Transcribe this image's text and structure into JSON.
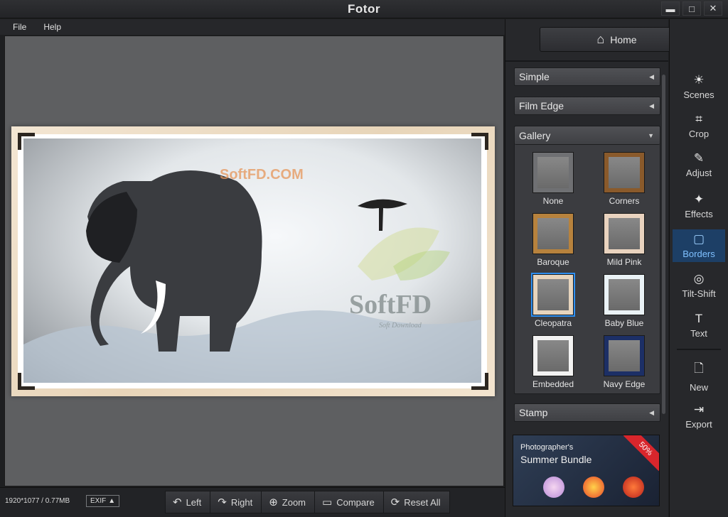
{
  "app": {
    "title": "Fotor"
  },
  "window_controls": {
    "minimize": "▬",
    "maximize": "□",
    "close": "✕"
  },
  "menu": [
    "File",
    "Help"
  ],
  "canvas": {
    "watermark_top": "SoftFD.COM",
    "watermark_big": "SoftFD",
    "watermark_small": "Soft Download"
  },
  "status": {
    "dimensions": "1920*1077 / 0.77MB",
    "exif": "EXIF"
  },
  "toolbar": [
    {
      "label": "Left",
      "icon": "rotate-left-icon"
    },
    {
      "label": "Right",
      "icon": "rotate-right-icon"
    },
    {
      "label": "Zoom",
      "icon": "zoom-icon"
    },
    {
      "label": "Compare",
      "icon": "compare-icon"
    },
    {
      "label": "Reset All",
      "icon": "reset-icon"
    }
  ],
  "home": {
    "label": "Home"
  },
  "accordion": {
    "simple": "Simple",
    "film_edge": "Film Edge",
    "gallery": "Gallery",
    "stamp": "Stamp"
  },
  "gallery_items": [
    {
      "label": "None",
      "color": "#6f7073"
    },
    {
      "label": "Corners",
      "color": "#8a5a2b"
    },
    {
      "label": "Baroque",
      "color": "#b7823d"
    },
    {
      "label": "Mild Pink",
      "color": "#e9d3bf"
    },
    {
      "label": "Cleopatra",
      "color": "#e6d4bd",
      "selected": true
    },
    {
      "label": "Baby Blue",
      "color": "#eaf2f6"
    },
    {
      "label": "Embedded",
      "color": "#f2f2f2"
    },
    {
      "label": "Navy Edge",
      "color": "#1c2f66"
    }
  ],
  "promo": {
    "line1": "Photographer's",
    "line2": "Summer Bundle",
    "badge": "50%"
  },
  "side_tools": [
    {
      "label": "Scenes",
      "icon": "☀"
    },
    {
      "label": "Crop",
      "icon": "⌗"
    },
    {
      "label": "Adjust",
      "icon": "✎"
    },
    {
      "label": "Effects",
      "icon": "✦"
    },
    {
      "label": "Borders",
      "icon": "▢",
      "active": true
    },
    {
      "label": "Tilt-Shift",
      "icon": "◎"
    },
    {
      "label": "Text",
      "icon": "T"
    },
    {
      "label": "New",
      "icon": "🗋"
    },
    {
      "label": "Export",
      "icon": "⇥"
    }
  ]
}
